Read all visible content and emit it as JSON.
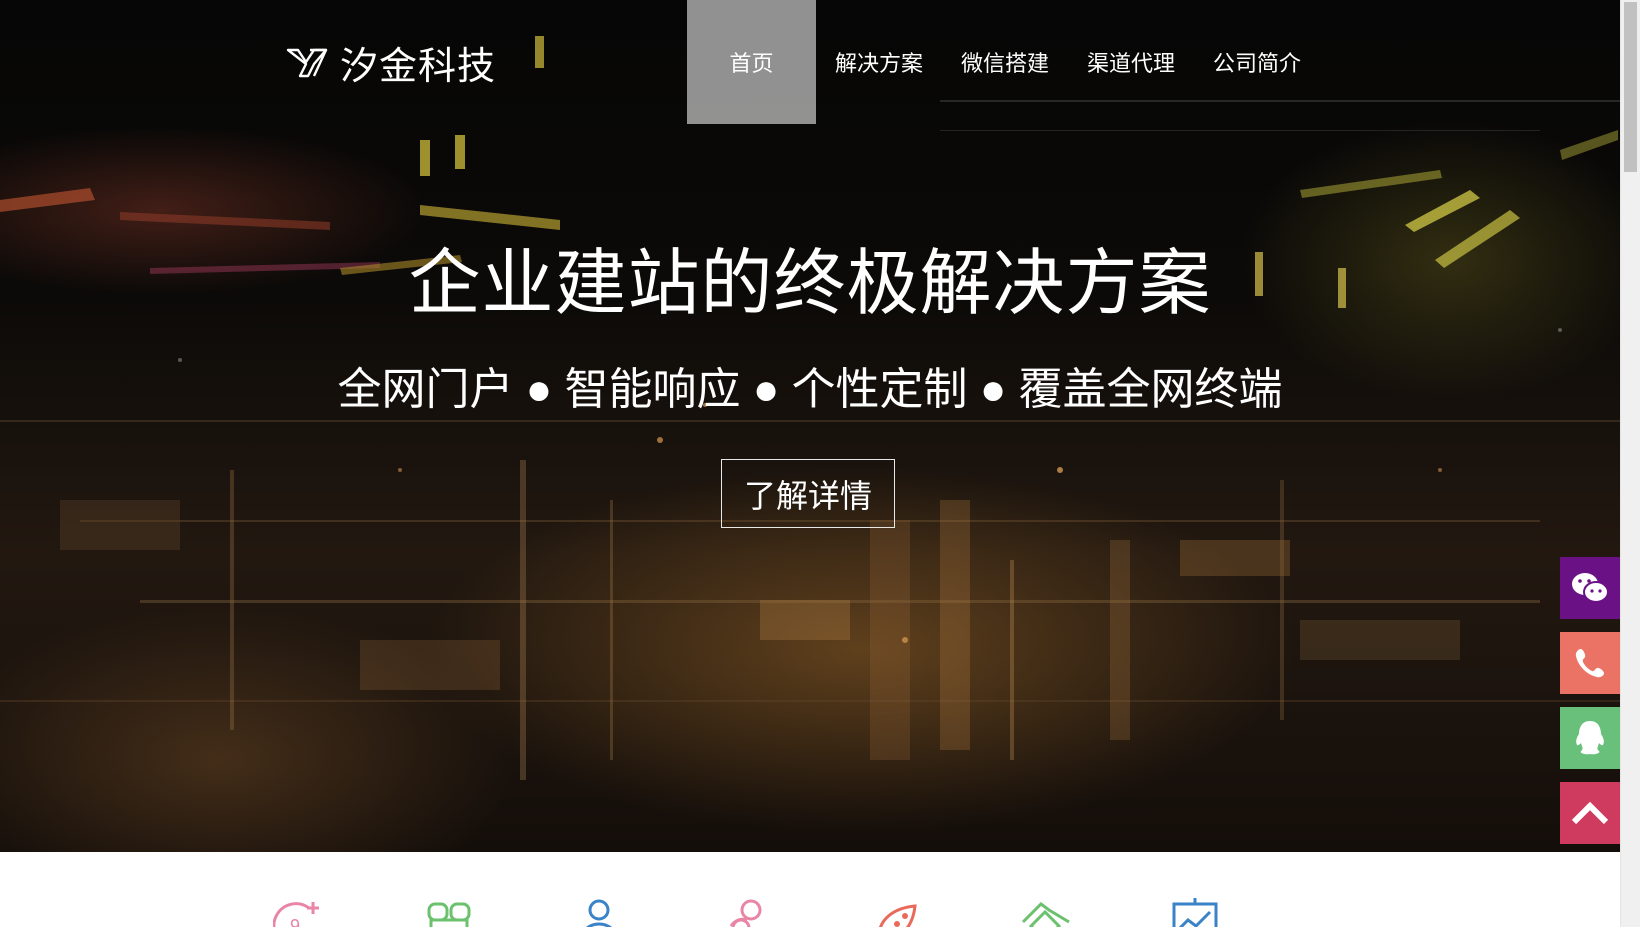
{
  "header": {
    "logo_icon": "xj-logo-mark",
    "brand_name": "汐金科技"
  },
  "nav": {
    "items": [
      {
        "label": "首页",
        "active": true
      },
      {
        "label": "解决方案",
        "active": false
      },
      {
        "label": "微信搭建",
        "active": false
      },
      {
        "label": "渠道代理",
        "active": false
      },
      {
        "label": "公司简介",
        "active": false
      }
    ]
  },
  "hero": {
    "title": "企业建站的终极解决方案",
    "subtitle": "全网门户 ● 智能响应 ● 个性定制 ● 覆盖全网终端",
    "button_label": "了解详情"
  },
  "side_bar": [
    {
      "icon": "wechat-icon",
      "color": "#6a1185"
    },
    {
      "icon": "phone-icon",
      "color": "#ea7366"
    },
    {
      "icon": "qq-icon",
      "color": "#69c07a"
    },
    {
      "icon": "back-to-top-icon",
      "color": "#cf3b5e"
    }
  ],
  "features": {
    "icons": [
      {
        "icon": "hot-plus-icon",
        "color": "#e986a6"
      },
      {
        "icon": "package-icon",
        "color": "#6cc16e"
      },
      {
        "icon": "user-icon",
        "color": "#3b83c8"
      },
      {
        "icon": "group-icon",
        "color": "#e986a6"
      },
      {
        "icon": "rocket-icon",
        "color": "#e96a5a"
      },
      {
        "icon": "handshake-icon",
        "color": "#6cc16e"
      },
      {
        "icon": "analytics-icon",
        "color": "#3b83c8"
      }
    ]
  },
  "colors": {
    "nav_active_bg": "#c8c8c8",
    "hero_text": "#ffffff"
  }
}
